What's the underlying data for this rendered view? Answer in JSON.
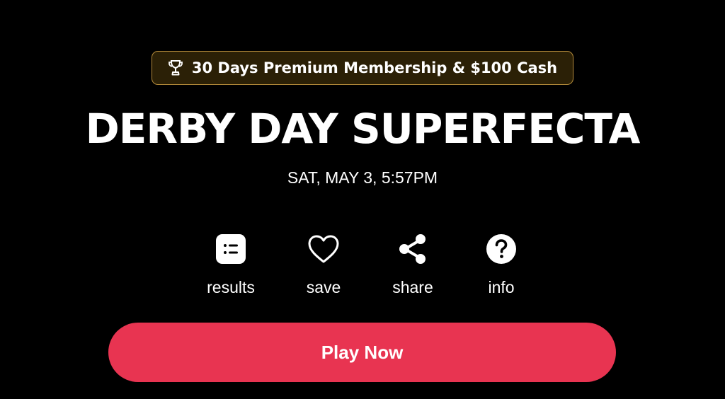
{
  "colors": {
    "background": "#000000",
    "badge_background": "#2b2006",
    "badge_border": "#b38a3a",
    "play_button": "#e83451",
    "text": "#ffffff"
  },
  "prize": {
    "icon": "trophy-icon",
    "text": "30 Days Premium Membership & $100 Cash"
  },
  "event": {
    "title": "DERBY DAY SUPERFECTA",
    "datetime": "SAT, MAY 3, 5:57PM"
  },
  "actions": [
    {
      "icon": "results-list-icon",
      "label": "results"
    },
    {
      "icon": "heart-icon",
      "label": "save"
    },
    {
      "icon": "share-icon",
      "label": "share"
    },
    {
      "icon": "help-circle-icon",
      "label": "info"
    }
  ],
  "play": {
    "label": "Play Now"
  }
}
